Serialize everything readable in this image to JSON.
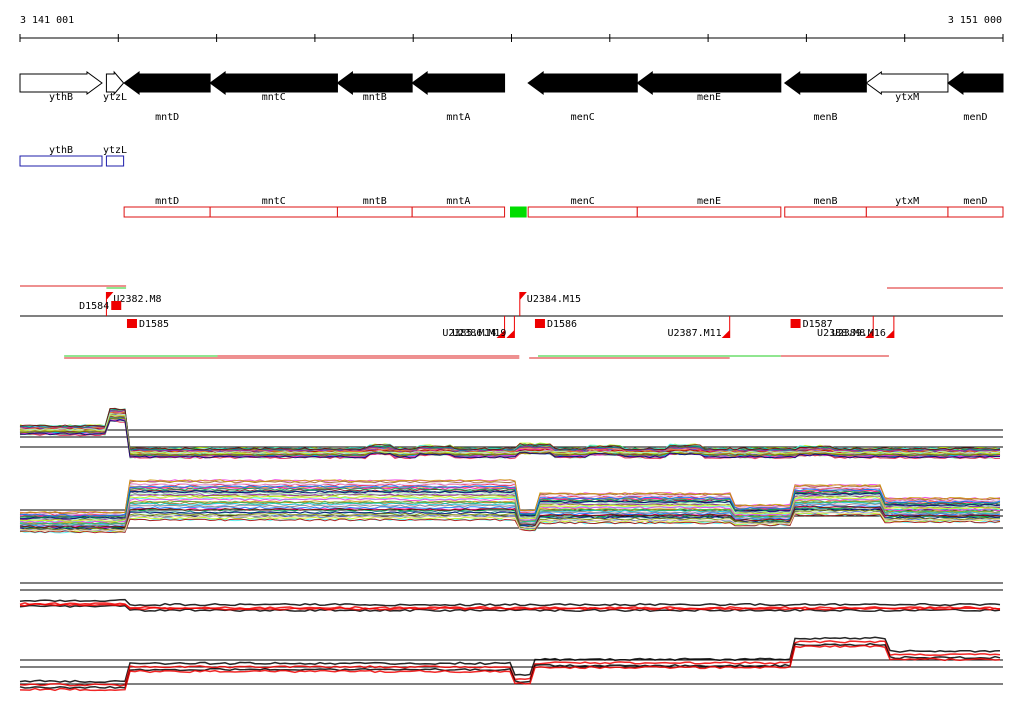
{
  "coordinates": {
    "start": "3 141 001",
    "end": "3 151 000",
    "range": [
      3141001,
      3151000
    ]
  },
  "colors": {
    "gene_fill_annotated": "#000000",
    "gene_fill_open": "#ffffff",
    "box_blue": "#1c1caa",
    "box_red": "#dd1111",
    "box_green": "#00dd00",
    "tss_red": "#ee0000",
    "seg_green": "#22cc22",
    "seg_red": "#dd2222"
  },
  "genes": [
    {
      "name": "ythB",
      "start": 3141001,
      "end": 3141835,
      "strand": "+",
      "style": "open",
      "label_row": "upper"
    },
    {
      "name": "ytzL",
      "start": 3141880,
      "end": 3142055,
      "strand": "+",
      "style": "open",
      "label_row": "upper"
    },
    {
      "name": "mntD",
      "start": 3142060,
      "end": 3142935,
      "strand": "-",
      "style": "filled",
      "label_row": "lower"
    },
    {
      "name": "mntC",
      "start": 3142935,
      "end": 3144230,
      "strand": "-",
      "style": "filled",
      "label_row": "upper"
    },
    {
      "name": "mntB",
      "start": 3144230,
      "end": 3144990,
      "strand": "-",
      "style": "filled",
      "label_row": "upper"
    },
    {
      "name": "mntA",
      "start": 3144990,
      "end": 3145930,
      "strand": "-",
      "style": "filled",
      "label_row": "lower"
    },
    {
      "name": "menC",
      "start": 3146170,
      "end": 3147280,
      "strand": "-",
      "style": "filled",
      "label_row": "lower"
    },
    {
      "name": "menE",
      "start": 3147280,
      "end": 3148740,
      "strand": "-",
      "style": "filled",
      "label_row": "upper"
    },
    {
      "name": "menB",
      "start": 3148780,
      "end": 3149610,
      "strand": "-",
      "style": "filled",
      "label_row": "lower"
    },
    {
      "name": "ytxM",
      "start": 3149610,
      "end": 3150440,
      "strand": "-",
      "style": "open",
      "label_row": "upper"
    },
    {
      "name": "menD",
      "start": 3150440,
      "end": 3151000,
      "strand": "-",
      "style": "filled",
      "label_row": "lower"
    }
  ],
  "plus_boxes": [
    {
      "name": "ythB",
      "start": 3141001,
      "end": 3141835
    },
    {
      "name": "ytzL",
      "start": 3141880,
      "end": 3142055
    }
  ],
  "minus_boxes": [
    {
      "name": "mntD",
      "start": 3142060,
      "end": 3142935
    },
    {
      "name": "mntC",
      "start": 3142935,
      "end": 3144230
    },
    {
      "name": "mntB",
      "start": 3144230,
      "end": 3144990
    },
    {
      "name": "mntA",
      "start": 3144990,
      "end": 3145930
    },
    {
      "name": "",
      "start": 3145970,
      "end": 3146170,
      "color": "green"
    },
    {
      "name": "menC",
      "start": 3146170,
      "end": 3147280
    },
    {
      "name": "menE",
      "start": 3147280,
      "end": 3148740
    },
    {
      "name": "menB",
      "start": 3148780,
      "end": 3149610
    },
    {
      "name": "ytxM",
      "start": 3149610,
      "end": 3150440
    },
    {
      "name": "menD",
      "start": 3150440,
      "end": 3151000
    }
  ],
  "upstream_sites": [
    {
      "name": "U2382.M8",
      "pos": 3141880,
      "row": "above",
      "label_side": "right"
    },
    {
      "name": "U2384.M15",
      "pos": 3146085,
      "row": "above",
      "label_side": "right"
    },
    {
      "name": "U2385.M14",
      "pos": 3145930,
      "row": "below",
      "label_side": "left"
    },
    {
      "name": "U2386.M19",
      "pos": 3146030,
      "row": "below",
      "label_side": "left"
    },
    {
      "name": "U2387.M11",
      "pos": 3148220,
      "row": "below",
      "label_side": "left"
    },
    {
      "name": "U2388.M8",
      "pos": 3149680,
      "row": "below",
      "label_side": "left"
    },
    {
      "name": "U2389.M16",
      "pos": 3149890,
      "row": "below",
      "label_side": "left"
    }
  ],
  "downstream_sites": [
    {
      "name": "D1584",
      "pos": 3141980,
      "row": "above",
      "label_side": "left"
    },
    {
      "name": "D1585",
      "pos": 3142140,
      "row": "below",
      "label_side": "right"
    },
    {
      "name": "D1586",
      "pos": 3146290,
      "row": "below",
      "label_side": "right"
    },
    {
      "name": "D1587",
      "pos": 3148890,
      "row": "below",
      "label_side": "right"
    }
  ],
  "segments": [
    {
      "start": 3141001,
      "end": 3142080,
      "row": 0,
      "color": "red"
    },
    {
      "start": 3141880,
      "end": 3142080,
      "row": 1,
      "color": "green"
    },
    {
      "start": 3141450,
      "end": 3143010,
      "row": 2,
      "color": "green"
    },
    {
      "start": 3143010,
      "end": 3146080,
      "row": 2,
      "color": "red"
    },
    {
      "start": 3141450,
      "end": 3146080,
      "row": 3,
      "color": "red"
    },
    {
      "start": 3146270,
      "end": 3148740,
      "row": 2,
      "color": "green"
    },
    {
      "start": 3148740,
      "end": 3149840,
      "row": 2,
      "color": "red"
    },
    {
      "start": 3146180,
      "end": 3148220,
      "row": 3,
      "color": "red"
    },
    {
      "start": 3149820,
      "end": 3151000,
      "row": 1,
      "color": "red"
    }
  ]
}
